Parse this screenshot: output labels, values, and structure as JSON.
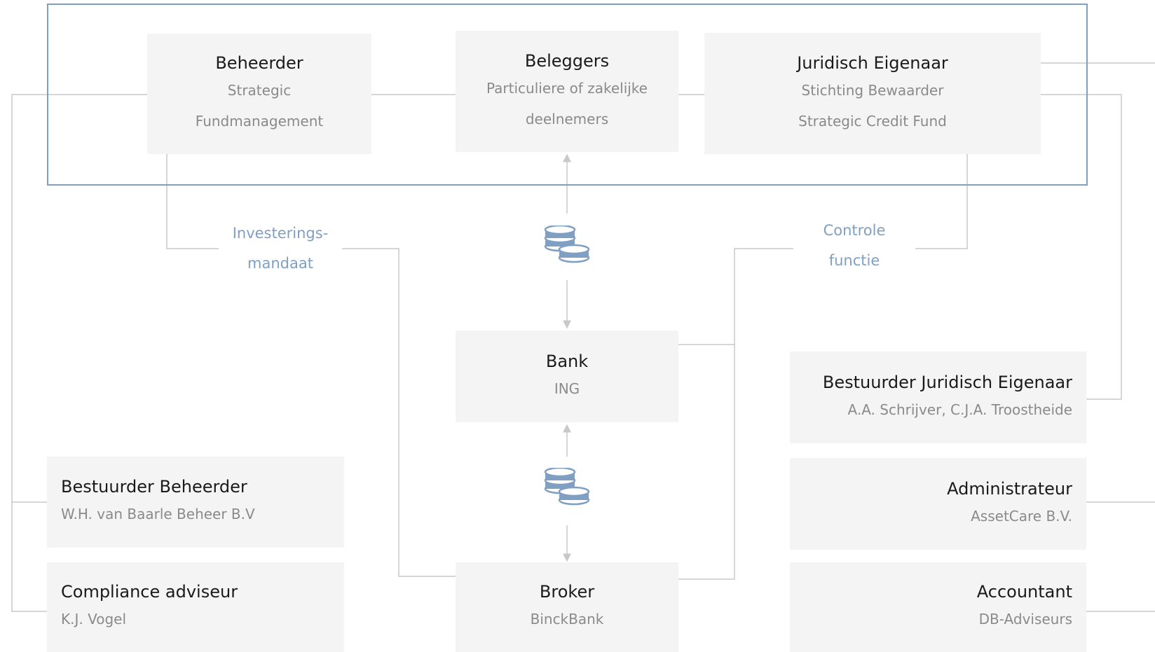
{
  "nodes": {
    "beheerder": {
      "title": "Beheerder",
      "sub1": "Strategic",
      "sub2": "Fundmanagement"
    },
    "beleggers": {
      "title": "Beleggers",
      "sub1": "Particuliere of zakelijke",
      "sub2": "deelnemers"
    },
    "juridisch_eigenaar": {
      "title": "Juridisch Eigenaar",
      "sub1": "Stichting Bewaarder",
      "sub2": "Strategic Credit Fund"
    },
    "bank": {
      "title": "Bank",
      "sub1": "ING"
    },
    "broker": {
      "title": "Broker",
      "sub1": "BinckBank"
    },
    "bestuurder_beheerder": {
      "title": "Bestuurder Beheerder",
      "sub1": "W.H. van Baarle Beheer B.V"
    },
    "compliance": {
      "title": "Compliance adviseur",
      "sub1": "K.J. Vogel"
    },
    "bestuurder_juridisch": {
      "title": "Bestuurder Juridisch Eigenaar",
      "sub1": "A.A. Schrijver, C.J.A. Troostheide"
    },
    "administrateur": {
      "title": "Administrateur",
      "sub1": "AssetCare B.V."
    },
    "accountant": {
      "title": "Accountant",
      "sub1": "DB-Adviseurs"
    }
  },
  "labels": {
    "investeringsmandaat_1": "Investerings-",
    "investeringsmandaat_2": "mandaat",
    "controle_1": "Controle",
    "controle_2": "functie"
  },
  "icons": {
    "coins": "coins-icon",
    "arrow": "arrow-icon"
  },
  "colors": {
    "frame": "#7f9fc3",
    "accent": "#7f9fc3",
    "box_bg": "#f4f4f4",
    "connector": "#c8c8c8",
    "title": "#1a1a1a",
    "subtitle": "#8a8a8a"
  }
}
